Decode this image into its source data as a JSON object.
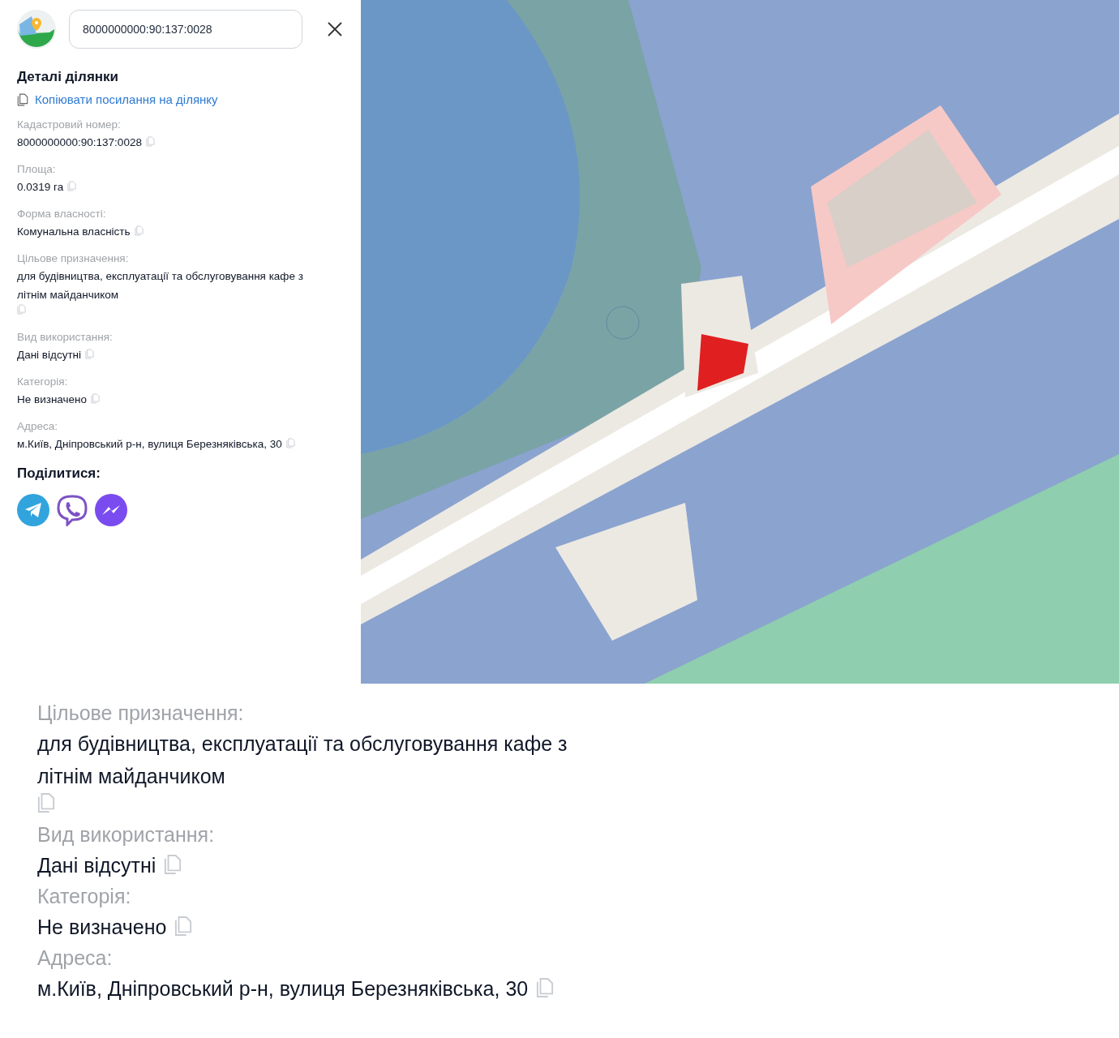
{
  "panel": {
    "search_value": "8000000000:90:137:0028",
    "title": "Деталі ділянки",
    "copy_link": "Копіювати посилання на ділянку",
    "fields": [
      {
        "label": "Кадастровий номер:",
        "value": "8000000000:90:137:0028"
      },
      {
        "label": "Площа:",
        "value": "0.0319 га"
      },
      {
        "label": "Форма власності:",
        "value": "Комунальна власність"
      },
      {
        "label": "Цільове призначення:",
        "value": "для будівництва, експлуатації та обслуговування кафе з літнім майданчиком"
      },
      {
        "label": "Вид використання:",
        "value": "Дані відсутні"
      },
      {
        "label": "Категорія:",
        "value": "Не визначено"
      },
      {
        "label": "Адреса:",
        "value": "м.Київ, Дніпровський р-н, вулиця Березняківська, 30"
      }
    ],
    "share_title": "Поділитися:",
    "share": [
      {
        "kind": "telegram"
      },
      {
        "kind": "viber"
      },
      {
        "kind": "messenger"
      }
    ]
  },
  "zoomed_fields": [
    {
      "label": "Цільове призначення:",
      "value": "для будівництва, експлуатації та обслуговування кафе з літнім майданчиком"
    },
    {
      "label": "Вид використання:",
      "value": "Дані відсутні"
    },
    {
      "label": "Категорія:",
      "value": "Не визначено"
    },
    {
      "label": "Адреса:",
      "value": "м.Київ, Дніпровський р-н, вулиця Березняківська, 30"
    }
  ]
}
